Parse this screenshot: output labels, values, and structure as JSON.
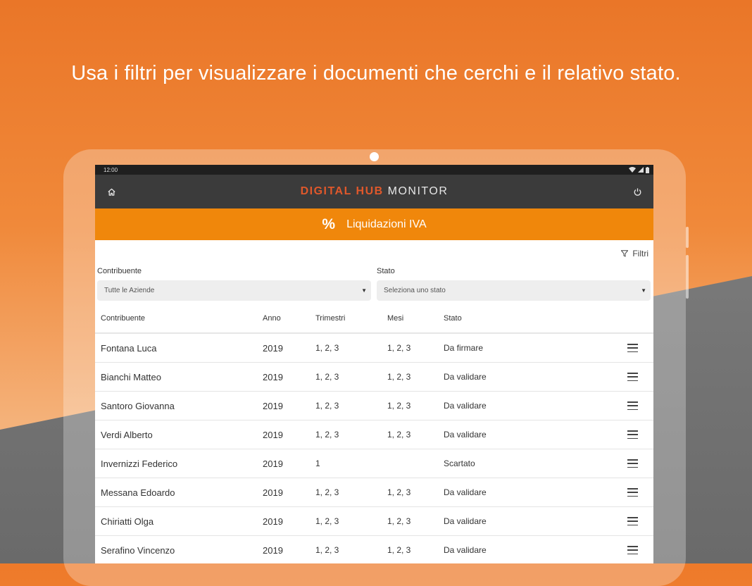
{
  "headline": "Usa i filtri per visualizzare i documenti che cerchi e il relativo stato.",
  "colors": {
    "accent_orange": "#f0870b",
    "brand_red": "#e0582b",
    "appbar": "#3b3b3b",
    "statusbar": "#1f1f1f"
  },
  "status_bar": {
    "time": "12:00",
    "icons": [
      "wifi-icon",
      "signal-icon",
      "battery-icon"
    ]
  },
  "app_bar": {
    "home_icon": "home-icon",
    "brand_strong": "DIGITAL HUB",
    "brand_light": "MONITOR",
    "power_icon": "power-icon"
  },
  "section": {
    "icon_text": "%",
    "title": "Liquidazioni IVA"
  },
  "filters": {
    "button_label": "Filtri",
    "contribuente": {
      "label": "Contribuente",
      "value": "Tutte le Aziende"
    },
    "stato": {
      "label": "Stato",
      "value": "Seleziona uno stato"
    }
  },
  "table": {
    "headers": [
      "Contribuente",
      "Anno",
      "Trimestri",
      "Mesi",
      "Stato"
    ],
    "rows": [
      {
        "contribuente": "Fontana Luca",
        "anno": "2019",
        "trimestri": "1, 2, 3",
        "mesi": "1, 2, 3",
        "stato": "Da firmare"
      },
      {
        "contribuente": "Bianchi Matteo",
        "anno": "2019",
        "trimestri": "1, 2, 3",
        "mesi": "1, 2, 3",
        "stato": "Da validare"
      },
      {
        "contribuente": "Santoro Giovanna",
        "anno": "2019",
        "trimestri": "1, 2, 3",
        "mesi": "1, 2, 3",
        "stato": "Da validare"
      },
      {
        "contribuente": "Verdi Alberto",
        "anno": "2019",
        "trimestri": "1, 2, 3",
        "mesi": "1, 2, 3",
        "stato": "Da validare"
      },
      {
        "contribuente": "Invernizzi Federico",
        "anno": "2019",
        "trimestri": "1",
        "mesi": "",
        "stato": "Scartato"
      },
      {
        "contribuente": "Messana Edoardo",
        "anno": "2019",
        "trimestri": "1, 2, 3",
        "mesi": "1, 2, 3",
        "stato": "Da validare"
      },
      {
        "contribuente": "Chiriatti Olga",
        "anno": "2019",
        "trimestri": "1, 2, 3",
        "mesi": "1, 2, 3",
        "stato": "Da validare"
      },
      {
        "contribuente": "Serafino Vincenzo",
        "anno": "2019",
        "trimestri": "1, 2, 3",
        "mesi": "1, 2, 3",
        "stato": "Da validare"
      }
    ]
  }
}
